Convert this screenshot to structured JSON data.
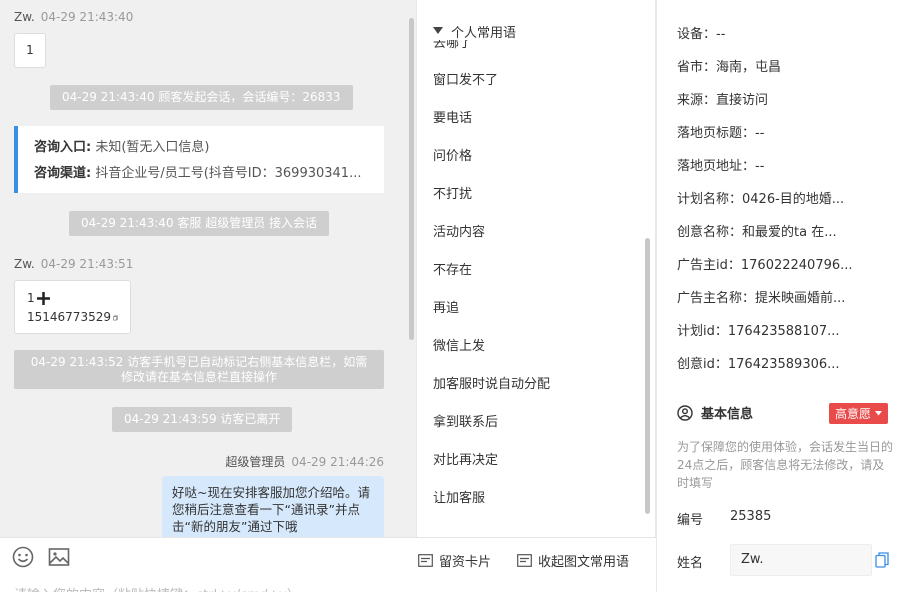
{
  "chat": {
    "msg1": {
      "sender": "Zw.",
      "time": "04-29 21:43:40",
      "text": "1"
    },
    "sys1": "04-29 21:43:40 顾客发起会话，会话编号：26833",
    "card": {
      "entry_label": "咨询入口:",
      "entry_value": "未知(暂无入口信息)",
      "channel_label": "咨询渠道:",
      "channel_value": "抖音企业号/员工号(抖音号ID：369930341..."
    },
    "sys2": "04-29 21:43:40 客服 超级管理员 接入会话",
    "msg2": {
      "sender": "Zw.",
      "time": "04-29 21:43:51",
      "line1": "1",
      "line2": "15146773529"
    },
    "sys3": "04-29 21:43:52 访客手机号已自动标记右侧基本信息栏，如需修改请在基本信息栏直接操作",
    "sys4": "04-29 21:43:59 访客已离开",
    "agent": {
      "name": "超级管理员",
      "time": "04-29 21:44:26",
      "text": "好哒~现在安排客服加您介绍哈。请您稍后注意查看一下“通讯录”并点击“新的朋友”通过下哦"
    }
  },
  "composer": {
    "emoji_icon": "smiley-icon",
    "image_icon": "image-icon",
    "save_card": "留资卡片",
    "collapse_phrases": "收起图文常用语",
    "placeholder": "请输入您的内容（粘贴快捷键：ctrl+v/cmd+v）"
  },
  "phrases": {
    "section_title": "个人常用语",
    "partial_item": "去哪了",
    "items": [
      "窗口发不了",
      "要电话",
      "问价格",
      "不打扰",
      "活动内容",
      "不存在",
      "再追",
      "微信上发",
      "加客服时说自动分配",
      "拿到联系后",
      "对比再决定",
      "让加客服"
    ]
  },
  "visitor": {
    "rows": [
      {
        "label": "设备：",
        "value": "--"
      },
      {
        "label": "省市：",
        "value": "海南，屯昌"
      },
      {
        "label": "来源：",
        "value": "直接访问"
      },
      {
        "label": "落地页标题：",
        "value": "--"
      },
      {
        "label": "落地页地址：",
        "value": "--"
      },
      {
        "label": "计划名称：",
        "value": "0426-目的地婚..."
      },
      {
        "label": "创意名称：",
        "value": "和最爱的ta 在..."
      },
      {
        "label": "广告主id：",
        "value": "176022240796..."
      },
      {
        "label": "广告主名称：",
        "value": "提米映画婚前..."
      },
      {
        "label": "计划id：",
        "value": "176423588107..."
      },
      {
        "label": "创意id：",
        "value": "176423589306..."
      }
    ],
    "basic_info_title": "基本信息",
    "intent_badge": "高意愿",
    "notice": "为了保障您的使用体验，会话发生当日的24点之后，顾客信息将无法修改，请及时填写",
    "id_label": "编号",
    "id_value": "25385",
    "name_label": "姓名",
    "name_value": "Zw."
  },
  "colors": {
    "accent": "#3a8ee6",
    "badge": "#e94a4a",
    "agent_bubble": "#d6e8fb",
    "system_pill": "#cfcfcf"
  }
}
